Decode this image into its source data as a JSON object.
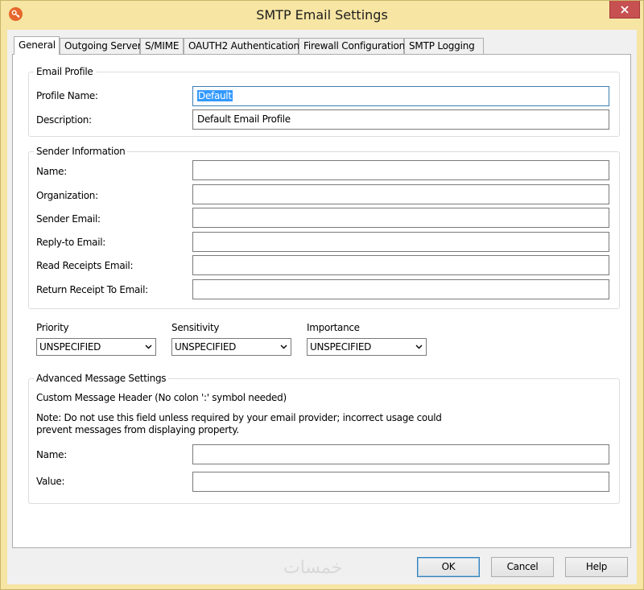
{
  "window": {
    "title": "SMTP Email Settings"
  },
  "tabs": [
    {
      "label": "General",
      "active": true
    },
    {
      "label": "Outgoing Server",
      "active": false
    },
    {
      "label": "S/MIME",
      "active": false
    },
    {
      "label": "OAUTH2 Authentication",
      "active": false
    },
    {
      "label": "Firewall Configuration",
      "active": false
    },
    {
      "label": "SMTP Logging",
      "active": false
    }
  ],
  "email_profile": {
    "legend": "Email Profile",
    "profile_name_label": "Profile Name:",
    "profile_name_value": "Default",
    "description_label": "Description:",
    "description_value": "Default Email Profile"
  },
  "sender_info": {
    "legend": "Sender Information",
    "name_label": "Name:",
    "name_value": "",
    "organization_label": "Organization:",
    "organization_value": "",
    "sender_email_label": "Sender Email:",
    "sender_email_value": "",
    "reply_to_label": "Reply-to Email:",
    "reply_to_value": "",
    "read_receipts_label": "Read Receipts Email:",
    "read_receipts_value": "",
    "return_receipt_label": "Return Receipt To Email:",
    "return_receipt_value": ""
  },
  "options": {
    "priority_label": "Priority",
    "priority_value": "UNSPECIFIED",
    "sensitivity_label": "Sensitivity",
    "sensitivity_value": "UNSPECIFIED",
    "importance_label": "Importance",
    "importance_value": "UNSPECIFIED"
  },
  "advanced": {
    "legend": "Advanced Message Settings",
    "header_caption": "Custom Message Header (No colon ':' symbol needed)",
    "note_line1": "Note: Do not use this field unless required by your email provider; incorrect usage could",
    "note_line2": "prevent messages from displaying property.",
    "name_label": "Name:",
    "name_value": "",
    "value_label": "Value:",
    "value_value": ""
  },
  "buttons": {
    "ok": "OK",
    "cancel": "Cancel",
    "help": "Help"
  },
  "watermark": "خمسات",
  "colors": {
    "titlebar": "#f6e5a3",
    "close": "#c75050",
    "selection": "#3399ff",
    "focus_border": "#3c7fb1",
    "app_icon": "#e6662b"
  }
}
